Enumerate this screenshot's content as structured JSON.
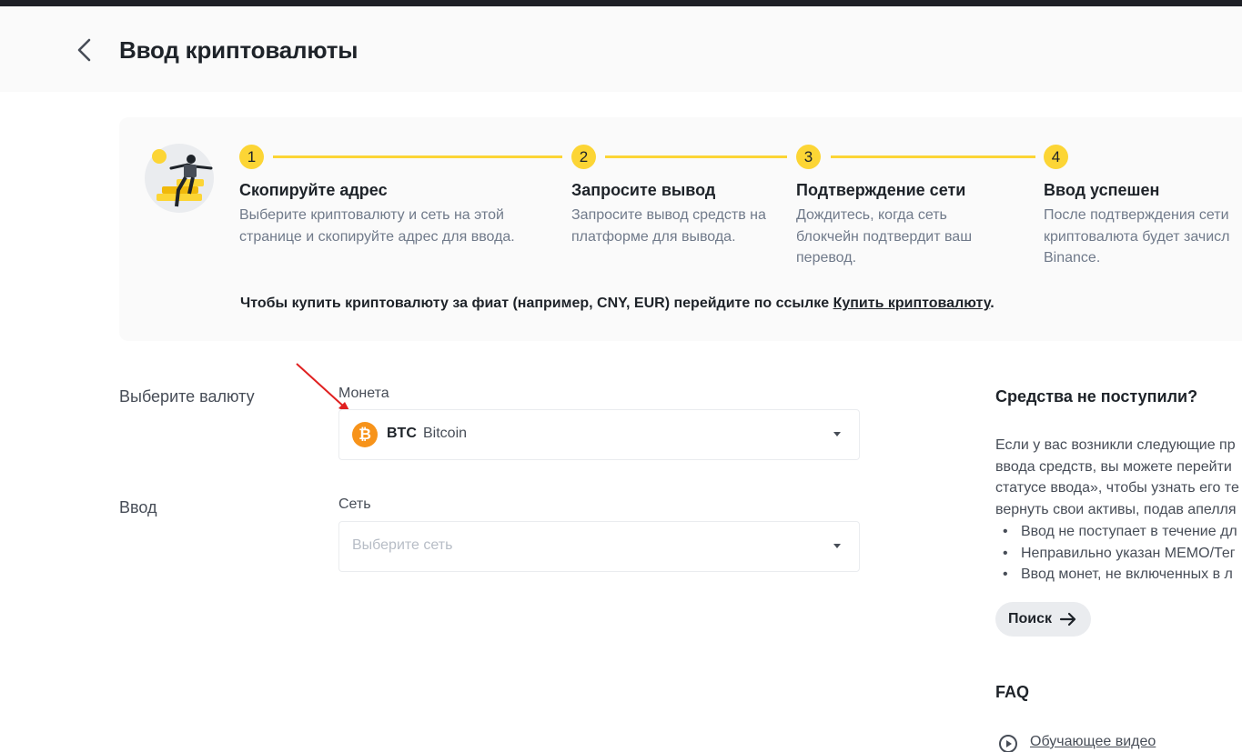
{
  "header": {
    "title": "Ввод криптовалюты"
  },
  "steps": [
    {
      "num": "1",
      "title": "Скопируйте адрес",
      "desc_lines": [
        "Выберите криптовалюту и сеть на этой",
        "странице и скопируйте адрес для ввода."
      ]
    },
    {
      "num": "2",
      "title": "Запросите вывод",
      "desc_lines": [
        "Запросите вывод средств на",
        "платформе для вывода."
      ]
    },
    {
      "num": "3",
      "title": "Подтверждение сети",
      "desc_lines": [
        "Дождитесь, когда сеть",
        "блокчейн подтвердит ваш",
        "перевод."
      ]
    },
    {
      "num": "4",
      "title": "Ввод успешен",
      "desc_lines": [
        "После подтверждения сети",
        "криптовалюта будет зачисл",
        "Binance."
      ]
    }
  ],
  "fiat_note": {
    "text": "Чтобы купить криптовалюту за фиат (например, CNY, EUR) перейдите по ссылке ",
    "link": "Купить криптовалюту",
    "suffix": "."
  },
  "form": {
    "currency_section_label": "Выберите валюту",
    "coin_label": "Монета",
    "coin_symbol": "BTC",
    "coin_name": "Bitcoin",
    "coin_icon_glyph": "₿",
    "deposit_section_label": "Ввод",
    "network_label": "Сеть",
    "network_placeholder": "Выберите сеть"
  },
  "sidebar": {
    "title": "Средства не поступили?",
    "text_lines": [
      "Если у вас возникли следующие пр",
      "ввода средств, вы можете перейти",
      "статусе ввода», чтобы узнать его те",
      "вернуть свои активы, подав апелля"
    ],
    "bullets": [
      "Ввод не поступает в течение дл",
      "Неправильно указан MEMO/Тег",
      "Ввод монет, не включенных в л"
    ],
    "search_button": "Поиск",
    "faq_title": "FAQ",
    "video_link": "Обучающее видео"
  },
  "colors": {
    "accent": "#fcd535",
    "btc": "#f7931a",
    "annotation_arrow": "#e02020"
  },
  "icons": {
    "back": "chevron-left-icon",
    "search_arrow": "arrow-right-icon",
    "video": "play-circle-icon",
    "dropdown": "caret-down-icon"
  }
}
